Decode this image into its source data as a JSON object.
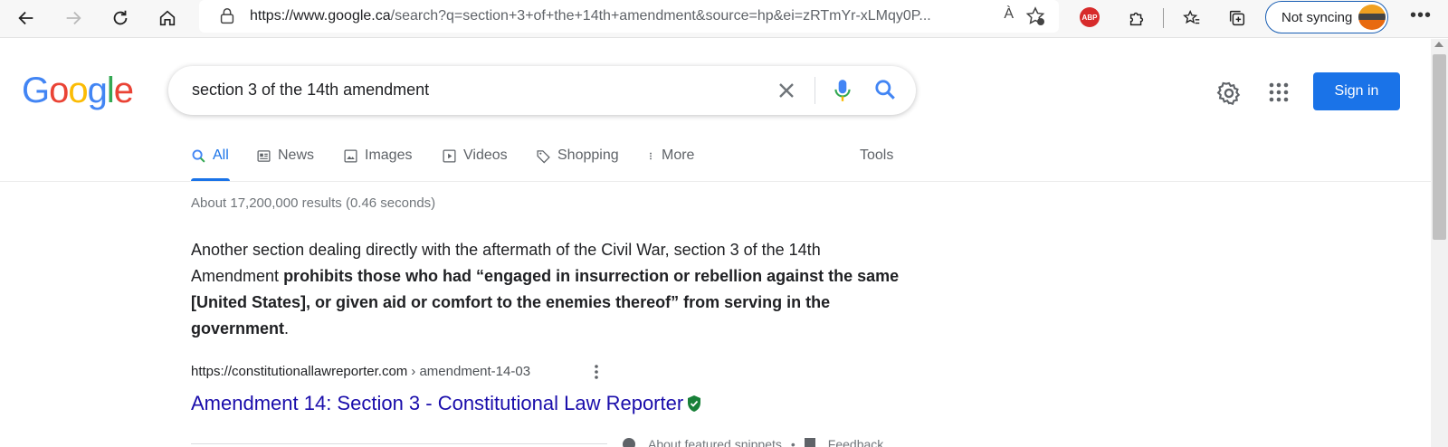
{
  "browser": {
    "url_host": "https://www.google.ca",
    "url_rest": "/search?q=section+3+of+the+14th+amendment&source=hp&ei=zRTmYr-xLMqy0P...",
    "read_aloud_label": "À",
    "sync_label": "Not syncing",
    "more_label": "•••",
    "abp_label": "ABP"
  },
  "google": {
    "logo_letters": [
      "G",
      "o",
      "o",
      "g",
      "l",
      "e"
    ],
    "search_query": "section 3 of the 14th amendment",
    "sign_in_label": "Sign in",
    "tabs": [
      {
        "label": "All",
        "icon": "search-icon"
      },
      {
        "label": "News",
        "icon": "news-icon"
      },
      {
        "label": "Images",
        "icon": "image-icon"
      },
      {
        "label": "Videos",
        "icon": "video-icon"
      },
      {
        "label": "Shopping",
        "icon": "tag-icon"
      },
      {
        "label": "More",
        "icon": "vertical-dots-icon"
      }
    ],
    "tools_label": "Tools",
    "result_stats": "About 17,200,000 results (0.46 seconds)"
  },
  "featured_snippet": {
    "text_plain": "Another section dealing directly with the aftermath of the Civil War, section 3 of the 14th Amendment ",
    "text_bold": "prohibits those who had “engaged in insurrection or rebellion against the same [United States], or given aid or comfort to the enemies thereof” from serving in the government",
    "text_end": "."
  },
  "result": {
    "cite_domain": "https://constitutionallawreporter.com",
    "cite_path": "› amendment-14-03",
    "title": "Amendment 14: Section 3 - Constitutional Law Reporter"
  },
  "footer": {
    "about_snippets": "About featured snippets",
    "separator": "•",
    "feedback": "Feedback"
  },
  "colors": {
    "accent_blue": "#1a73e8",
    "link_title": "#1a0dab",
    "verified_green": "#188038"
  }
}
